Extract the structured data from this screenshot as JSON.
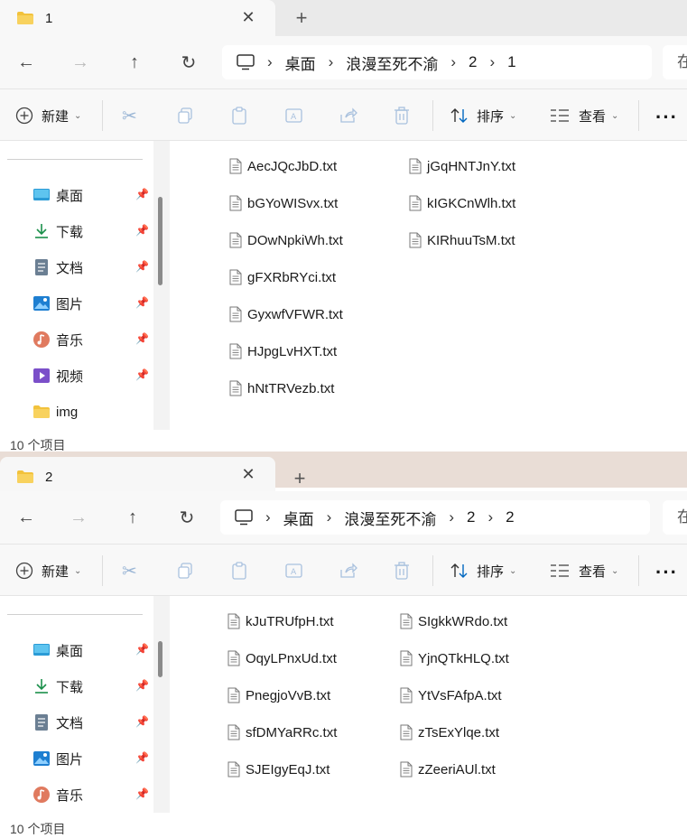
{
  "windows": [
    {
      "tab_title": "1",
      "breadcrumb": [
        "桌面",
        "浪漫至死不渝",
        "2",
        "1"
      ],
      "search_placeholder": "在",
      "toolbar": {
        "new_label": "新建",
        "sort_label": "排序",
        "view_label": "查看"
      },
      "sidebar": [
        {
          "label": "桌面",
          "icon": "desktop-icon",
          "pinned": true
        },
        {
          "label": "下载",
          "icon": "download-icon",
          "pinned": true
        },
        {
          "label": "文档",
          "icon": "document-icon",
          "pinned": true
        },
        {
          "label": "图片",
          "icon": "pictures-icon",
          "pinned": true
        },
        {
          "label": "音乐",
          "icon": "music-icon",
          "pinned": true
        },
        {
          "label": "视频",
          "icon": "video-icon",
          "pinned": true
        },
        {
          "label": "img",
          "icon": "folder-icon",
          "pinned": false
        }
      ],
      "files_col1": [
        "AecJQcJbD.txt",
        "bGYoWISvx.txt",
        "DOwNpkiWh.txt",
        "gFXRbRYci.txt",
        "GyxwfVFWR.txt",
        "HJpgLvHXT.txt",
        "hNtTRVezb.txt"
      ],
      "files_col2": [
        "jGqHNTJnY.txt",
        "kIGKCnWlh.txt",
        "KIRhuuTsM.txt"
      ],
      "status": "10 个项目"
    },
    {
      "tab_title": "2",
      "breadcrumb": [
        "桌面",
        "浪漫至死不渝",
        "2",
        "2"
      ],
      "search_placeholder": "在",
      "toolbar": {
        "new_label": "新建",
        "sort_label": "排序",
        "view_label": "查看"
      },
      "sidebar": [
        {
          "label": "桌面",
          "icon": "desktop-icon",
          "pinned": true
        },
        {
          "label": "下载",
          "icon": "download-icon",
          "pinned": true
        },
        {
          "label": "文档",
          "icon": "document-icon",
          "pinned": true
        },
        {
          "label": "图片",
          "icon": "pictures-icon",
          "pinned": true
        },
        {
          "label": "音乐",
          "icon": "music-icon",
          "pinned": true
        }
      ],
      "files_col1": [
        "kJuTRUfpH.txt",
        "OqyLPnxUd.txt",
        "PnegjoVvB.txt",
        "sfDMYaRRc.txt",
        "SJEIgyEqJ.txt"
      ],
      "files_col2": [
        "SIgkkWRdo.txt",
        "YjnQTkHLQ.txt",
        "YtVsFAfpA.txt",
        "zTsExYlqe.txt",
        "zZeeriAUl.txt"
      ],
      "status": "10 个项目"
    }
  ],
  "colors": {
    "folder": "#f2c23c",
    "accent": "#0067c0"
  }
}
